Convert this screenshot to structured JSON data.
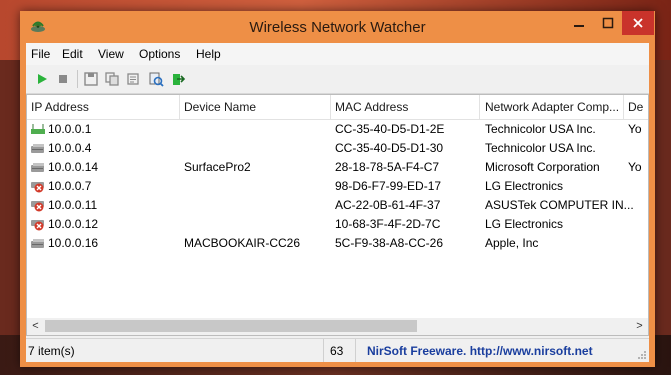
{
  "window": {
    "title": "Wireless Network Watcher"
  },
  "menu": [
    "File",
    "Edit",
    "View",
    "Options",
    "Help"
  ],
  "toolbar": [
    {
      "name": "start-icon",
      "color": "#2bb33c"
    },
    {
      "name": "stop-icon",
      "color": "#7a7a7a"
    },
    {
      "name": "save-icon",
      "color": "#7a7a7a"
    },
    {
      "name": "copy-icon",
      "color": "#7a7a7a"
    },
    {
      "name": "properties-icon",
      "color": "#7a7a7a"
    },
    {
      "name": "refresh-icon",
      "color": "#2a6fbf"
    },
    {
      "name": "exit-icon",
      "color": "#2bb33c"
    }
  ],
  "table": {
    "columns": [
      "IP Address",
      "Device Name",
      "MAC Address",
      "Network Adapter Comp...",
      "De"
    ],
    "rows": [
      {
        "icon": "router-icon",
        "ip": "10.0.0.1",
        "device": "",
        "mac": "CC-35-40-D5-D1-2E",
        "vendor": "Technicolor USA Inc.",
        "extra": "Yo"
      },
      {
        "icon": "device-icon",
        "ip": "10.0.0.4",
        "device": "",
        "mac": "CC-35-40-D5-D1-30",
        "vendor": "Technicolor USA Inc.",
        "extra": ""
      },
      {
        "icon": "device-icon",
        "ip": "10.0.0.14",
        "device": "SurfacePro2",
        "mac": "28-18-78-5A-F4-C7",
        "vendor": "Microsoft Corporation",
        "extra": "Yo"
      },
      {
        "icon": "device-error-icon",
        "ip": "10.0.0.7",
        "device": "",
        "mac": "98-D6-F7-99-ED-17",
        "vendor": "LG Electronics",
        "extra": ""
      },
      {
        "icon": "device-error-icon",
        "ip": "10.0.0.11",
        "device": "",
        "mac": "AC-22-0B-61-4F-37",
        "vendor": "ASUSTek COMPUTER IN...",
        "extra": ""
      },
      {
        "icon": "device-error-icon",
        "ip": "10.0.0.12",
        "device": "",
        "mac": "10-68-3F-4F-2D-7C",
        "vendor": "LG Electronics",
        "extra": ""
      },
      {
        "icon": "device-icon",
        "ip": "10.0.0.16",
        "device": "MACBOOKAIR-CC26",
        "mac": "5C-F9-38-A8-CC-26",
        "vendor": "Apple, Inc",
        "extra": ""
      }
    ]
  },
  "status": {
    "count": "7 item(s)",
    "number": "63",
    "credit": "NirSoft Freeware.  http://www.nirsoft.net"
  },
  "colors": {
    "titlebar": "#ee8f46",
    "close_button": "#c9332b",
    "link": "#1a3e9e"
  }
}
